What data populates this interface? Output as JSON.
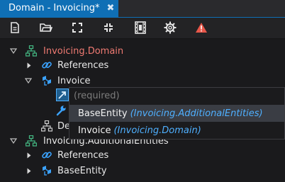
{
  "tab": {
    "title": "Domain - Invoicing*",
    "close_glyph": "✖"
  },
  "toolbar": {
    "buttons": [
      {
        "name": "new-document-icon"
      },
      {
        "name": "open-folder-icon"
      },
      {
        "name": "expand-icon"
      },
      {
        "name": "collapse-icon"
      },
      {
        "name": "film-strip-icon"
      },
      {
        "name": "settings-gear-icon"
      },
      {
        "name": "warning-icon"
      }
    ]
  },
  "tree": {
    "root1": {
      "label": "Invoicing.Domain"
    },
    "references1": {
      "label": "References"
    },
    "invoice": {
      "label": "Invoice"
    },
    "de_partial": {
      "label": "De"
    },
    "root2": {
      "label": "Invoicing.AdditionalEntities"
    },
    "references2": {
      "label": "References"
    },
    "baseentity": {
      "label": "BaseEntity"
    }
  },
  "popup": {
    "placeholder": "(required)",
    "options": [
      {
        "name": "BaseEntity",
        "namespace": "(Invoicing.AdditionalEntities)"
      },
      {
        "name": "Invoice",
        "namespace": "(Invoicing.Domain)"
      }
    ]
  },
  "colors": {
    "accent": "#0f6fb5",
    "domain_label": "#ef7a72",
    "namespace": "#4fb0ff",
    "selected_row": "#3a3d44"
  }
}
